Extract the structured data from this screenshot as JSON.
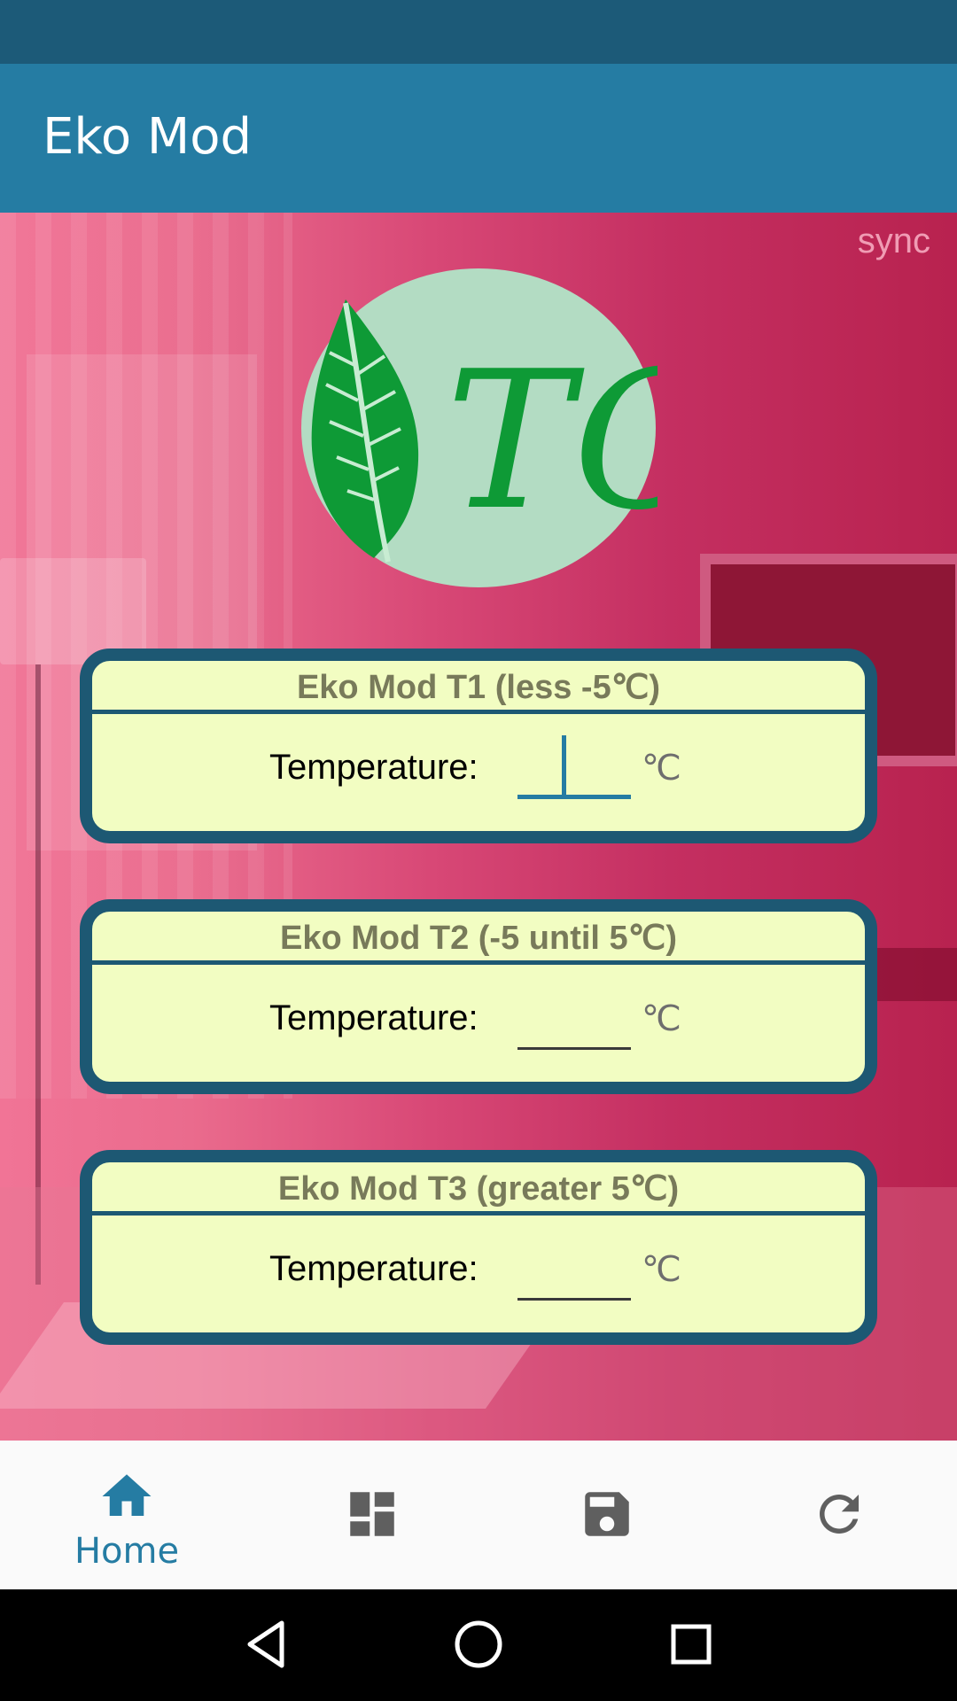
{
  "app": {
    "title": "Eko Mod"
  },
  "sync_label": "sync",
  "logo_text": "TO",
  "cards": [
    {
      "title": "Eko Mod T1 (less -5℃)",
      "label": "Temperature:",
      "value": "",
      "unit": "℃",
      "focused": true
    },
    {
      "title": "Eko Mod T2 (-5 until 5℃)",
      "label": "Temperature:",
      "value": "",
      "unit": "℃",
      "focused": false
    },
    {
      "title": "Eko Mod T3 (greater 5℃)",
      "label": "Temperature:",
      "value": "",
      "unit": "℃",
      "focused": false
    }
  ],
  "bottom_nav": {
    "items": [
      {
        "label": "Home",
        "icon": "home-icon",
        "active": true
      },
      {
        "label": "",
        "icon": "dashboard-icon",
        "active": false
      },
      {
        "label": "",
        "icon": "save-icon",
        "active": false
      },
      {
        "label": "",
        "icon": "refresh-icon",
        "active": false
      }
    ]
  },
  "colors": {
    "app_bar": "#257ca3",
    "status_bar": "#1c5a78",
    "card_bg": "#f2fdc2",
    "card_border": "#1d5873",
    "nav_active": "#257ca3",
    "nav_inactive": "#5f5f5f",
    "logo_circle": "#b3dcc3",
    "logo_green": "#0e9a36"
  }
}
